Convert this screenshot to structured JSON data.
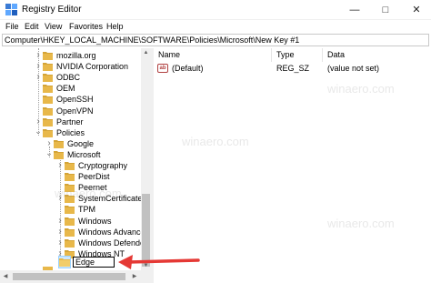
{
  "window": {
    "title": "Registry Editor",
    "controls": {
      "minimize": "—",
      "maximize": "□",
      "close": "✕"
    }
  },
  "menu": [
    "File",
    "Edit",
    "View",
    "Favorites",
    "Help"
  ],
  "address": "Computer\\HKEY_LOCAL_MACHINE\\SOFTWARE\\Policies\\Microsoft\\New Key #1",
  "tree": {
    "items": [
      {
        "label": "mozilla.org",
        "level": 1,
        "expander": "collapsed"
      },
      {
        "label": "NVIDIA Corporation",
        "level": 1,
        "expander": "collapsed"
      },
      {
        "label": "ODBC",
        "level": 1,
        "expander": "collapsed"
      },
      {
        "label": "OEM",
        "level": 1,
        "expander": "none"
      },
      {
        "label": "OpenSSH",
        "level": 1,
        "expander": "none"
      },
      {
        "label": "OpenVPN",
        "level": 1,
        "expander": "none"
      },
      {
        "label": "Partner",
        "level": 1,
        "expander": "collapsed"
      },
      {
        "label": "Policies",
        "level": 1,
        "expander": "expanded"
      },
      {
        "label": "Google",
        "level": 2,
        "expander": "collapsed"
      },
      {
        "label": "Microsoft",
        "level": 2,
        "expander": "expanded"
      },
      {
        "label": "Cryptography",
        "level": 3,
        "expander": "collapsed"
      },
      {
        "label": "PeerDist",
        "level": 3,
        "expander": "none"
      },
      {
        "label": "Peernet",
        "level": 3,
        "expander": "none"
      },
      {
        "label": "SystemCertificates",
        "level": 3,
        "expander": "collapsed"
      },
      {
        "label": "TPM",
        "level": 3,
        "expander": "none"
      },
      {
        "label": "Windows",
        "level": 3,
        "expander": "collapsed"
      },
      {
        "label": "Windows Advanced",
        "level": 3,
        "expander": "collapsed"
      },
      {
        "label": "Windows Defender",
        "level": 3,
        "expander": "collapsed"
      },
      {
        "label": "Windows NT",
        "level": 3,
        "expander": "collapsed"
      }
    ],
    "rename_value": "Edge"
  },
  "list": {
    "columns": [
      "Name",
      "Type",
      "Data"
    ],
    "rows": [
      {
        "name": "(Default)",
        "type": "REG_SZ",
        "data": "(value not set)",
        "icon": "ab-string-icon"
      }
    ]
  },
  "watermark": "winaero.com",
  "colors": {
    "folder": "#e8b84a",
    "folder_dark": "#d4a437",
    "arrow": "#e53935",
    "selection": "#cce8ff"
  }
}
